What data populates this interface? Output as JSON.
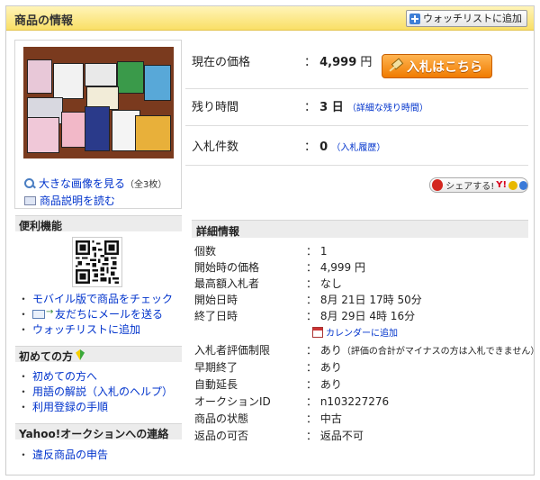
{
  "header": {
    "title": "商品の情報",
    "watchlist_button": "ウォッチリストに追加"
  },
  "left": {
    "view_large_image": "大きな画像を見る",
    "image_count": "（全3枚）",
    "read_description": "商品説明を読む",
    "useful": {
      "title": "便利機能",
      "items": [
        "モバイル版で商品をチェック",
        "友だちにメールを送る",
        "ウォッチリストに追加"
      ]
    },
    "beginners": {
      "title": "初めての方",
      "items": [
        "初めての方へ",
        "用語の解説（入札のヘルプ）",
        "利用登録の手順"
      ]
    },
    "contact": {
      "title": "Yahoo!オークションへの連絡",
      "items": [
        "違反商品の申告"
      ]
    }
  },
  "summary": {
    "price_label": "現在の価格",
    "price_value": "4,999",
    "price_unit": "円",
    "bid_button": "入札はこちら",
    "remaining_label": "残り時間",
    "remaining_value": "3 日",
    "remaining_link": "（詳細な残り時間）",
    "bids_label": "入札件数",
    "bids_value": "0",
    "bids_link": "（入札履歴）",
    "share_button": "シェアする!"
  },
  "details": {
    "title": "詳細情報",
    "rows": [
      {
        "label": "個数",
        "value": "1"
      },
      {
        "label": "開始時の価格",
        "value": "4,999 円"
      },
      {
        "label": "最高額入札者",
        "value": "なし"
      },
      {
        "label": "開始日時",
        "value": "8月 21日 17時 50分"
      },
      {
        "label": "終了日時",
        "value": "8月 29日 4時 16分"
      },
      {
        "label": "入札者評価制限",
        "value": "あり",
        "note": "（評価の合計がマイナスの方は入札できません）"
      },
      {
        "label": "早期終了",
        "value": "あり"
      },
      {
        "label": "自動延長",
        "value": "あり"
      },
      {
        "label": "オークションID",
        "value": "n103227276"
      },
      {
        "label": "商品の状態",
        "value": "中古"
      },
      {
        "label": "返品の可否",
        "value": "返品不可"
      }
    ],
    "calendar_link": "カレンダーに追加"
  },
  "colors": {
    "header_bg": "#f9df66",
    "link": "#0033cc",
    "bid_button": "#f07b00"
  }
}
